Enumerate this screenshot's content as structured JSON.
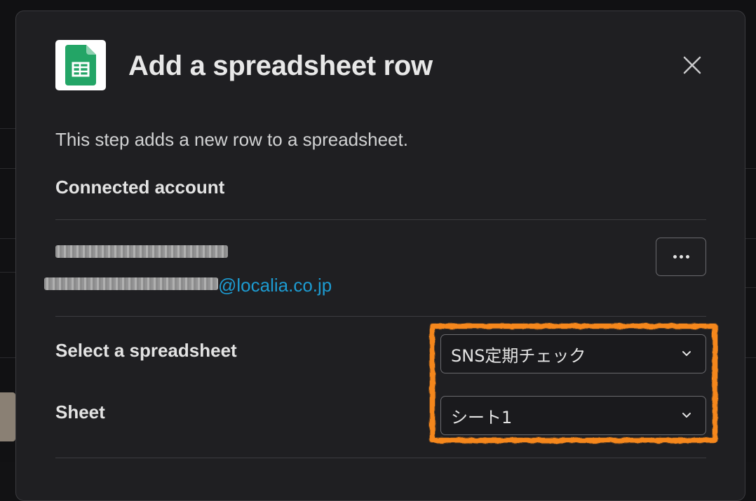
{
  "modal": {
    "title": "Add a spreadsheet row",
    "description": "This step adds a new row to a spreadsheet.",
    "app_icon": "google-sheets-icon",
    "close_icon": "close-icon"
  },
  "account": {
    "section_label": "Connected account",
    "email_domain": "@localia.co.jp",
    "more_icon": "more-horizontal-icon"
  },
  "fields": {
    "spreadsheet": {
      "label": "Select a spreadsheet",
      "value": "SNS定期チェック"
    },
    "sheet": {
      "label": "Sheet",
      "value": "シート1"
    }
  },
  "colors": {
    "accent_link": "#1d9bd1",
    "highlight": "#f5871f",
    "sheets_green": "#23a566"
  }
}
